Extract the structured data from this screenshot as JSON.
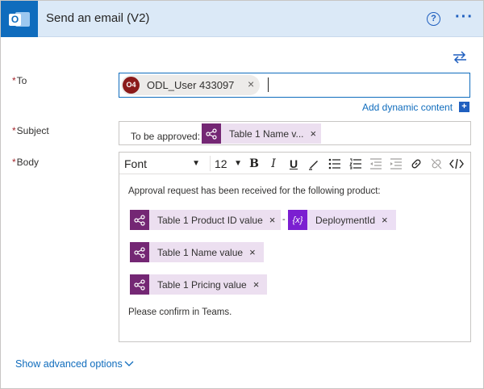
{
  "header": {
    "title": "Send an email (V2)",
    "app_icon": "outlook-icon",
    "help_icon": "help-icon",
    "more_icon": "more-options-icon",
    "accent": "#0f6cbd",
    "background": "#dbe9f7"
  },
  "fields": {
    "to_label": "To",
    "subject_label": "Subject",
    "body_label": "Body",
    "required_marker": "*"
  },
  "to": {
    "avatar_initials": "O4",
    "recipient": "ODL_User 433097",
    "remove": "×"
  },
  "add_dynamic_content": {
    "label": "Add dynamic content",
    "plus": "+"
  },
  "subject": {
    "prefix": "To be approved:",
    "token": "Table 1 Name v...",
    "remove": "×"
  },
  "toolbar": {
    "font": "Font",
    "size": "12",
    "dropdown_arrow": "▼",
    "buttons": [
      "bold",
      "italic",
      "underline",
      "highlight",
      "bulleted-list",
      "numbered-list",
      "decrease-indent",
      "increase-indent",
      "link",
      "unlink",
      "code-view"
    ],
    "bold": "B",
    "italic": "I",
    "underline": "U"
  },
  "body": {
    "intro": "Approval request has been received for the following product:",
    "token_product_id": "Table 1 Product ID value",
    "separator": "-",
    "expr_symbol": "{x}",
    "token_deployment": "DeploymentId",
    "token_name": "Table 1 Name value",
    "token_pricing": "Table 1 Pricing value",
    "remove": "×",
    "closing": "Please confirm in Teams."
  },
  "advanced": {
    "label": "Show advanced options"
  }
}
